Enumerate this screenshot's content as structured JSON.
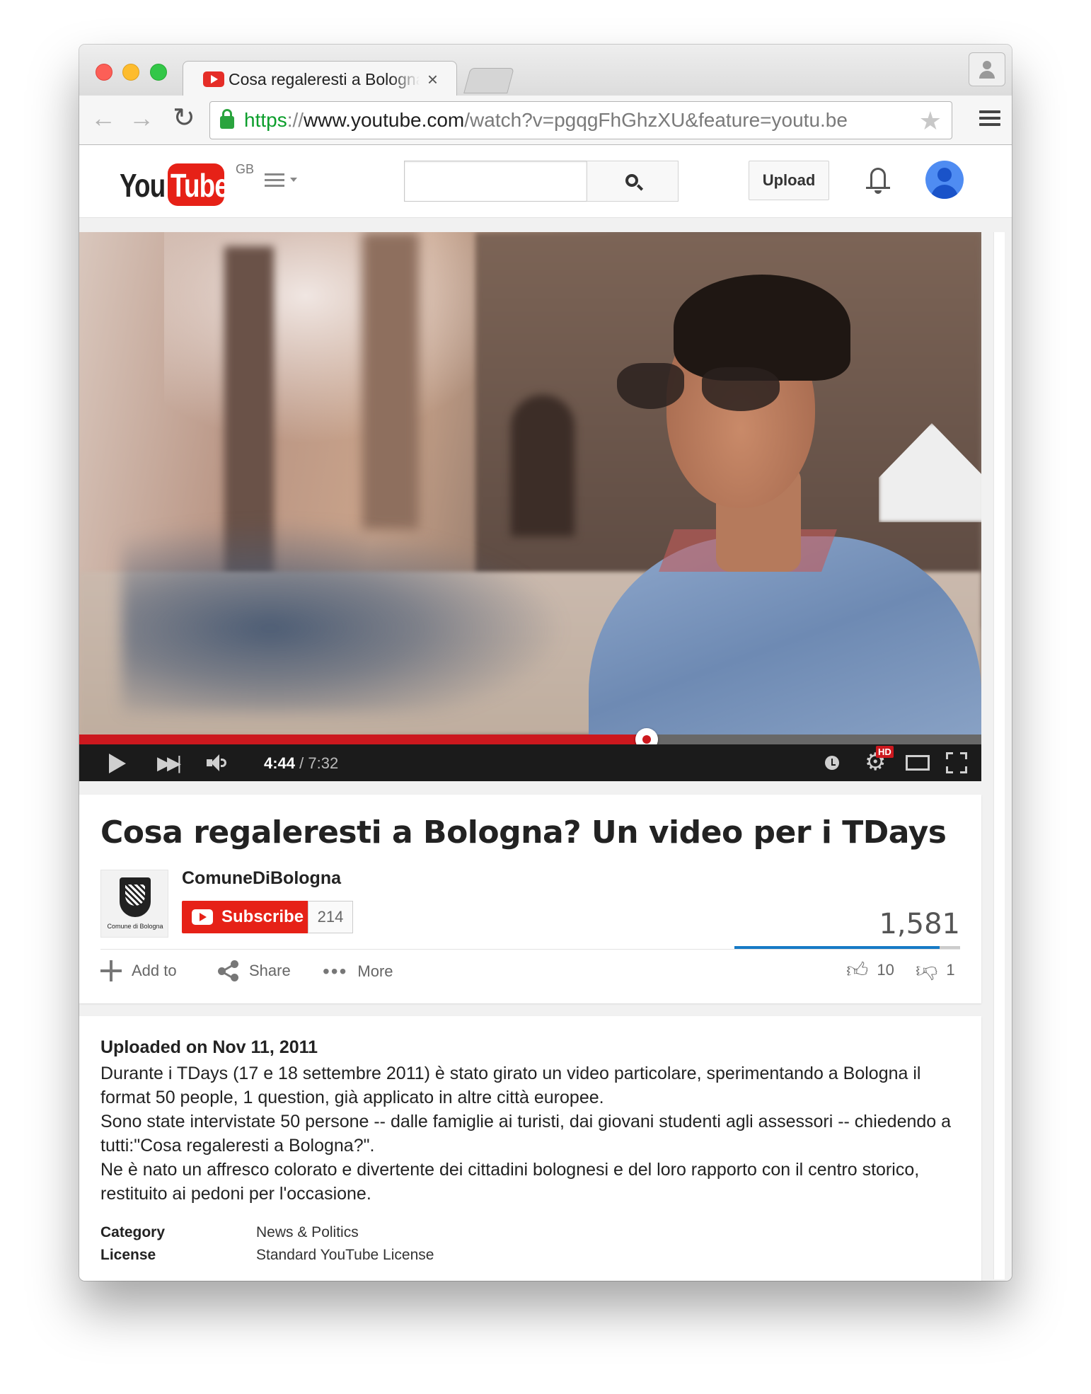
{
  "browser": {
    "tab_title": "Cosa regaleresti a Bologna? Un video per i TDays",
    "url": {
      "scheme": "https",
      "separator": "://",
      "host": "www.youtube.com",
      "path": "/watch?v=pgqgFhGhzXU&feature=youtu.be"
    },
    "icons": {
      "back": "back-arrow-icon",
      "forward": "forward-arrow-icon",
      "reload": "reload-icon",
      "lock": "lock-icon",
      "star": "bookmark-star-icon",
      "menu": "hamburger-menu-icon",
      "profile": "person-icon",
      "tab_close": "close-icon"
    }
  },
  "masthead": {
    "logo_you": "You",
    "logo_tube": "Tube",
    "region": "GB",
    "search_placeholder": "",
    "upload_label": "Upload",
    "brand_color": "#e62117"
  },
  "player": {
    "current_time": "4:44",
    "duration": "7:32",
    "progress_fraction": 0.629,
    "hd_badge": "HD",
    "accent_color": "#cc181e"
  },
  "video": {
    "title": "Cosa regaleresti a Bologna? Un video per i TDays",
    "channel_name": "ComuneDiBologna",
    "channel_thumb_label": "Comune di Bologna",
    "subscribe_label": "Subscribe",
    "subscriber_count": "214",
    "view_count": "1,581",
    "likes": "10",
    "dislikes": "1",
    "like_fraction": 0.909,
    "actions": {
      "add_to": "Add to",
      "share": "Share",
      "more": "More"
    }
  },
  "description": {
    "uploaded": "Uploaded on Nov 11, 2011",
    "paragraphs": [
      "Durante i TDays (17 e 18 settembre 2011) è stato girato un video particolare, sperimentando a Bologna il format 50 people, 1 question, già applicato in altre città europee.",
      "Sono state intervistate 50 persone -- dalle famiglie ai turisti, dai giovani studenti agli assessori -- chiedendo a tutti:\"Cosa regaleresti a Bologna?\".",
      "Ne è nato un affresco colorato e divertente dei cittadini bolognesi e del loro rapporto con il centro storico, restituito ai pedoni per l'occasione."
    ],
    "category_label": "Category",
    "category_value": "News & Politics",
    "license_label": "License",
    "license_value": "Standard YouTube License"
  }
}
